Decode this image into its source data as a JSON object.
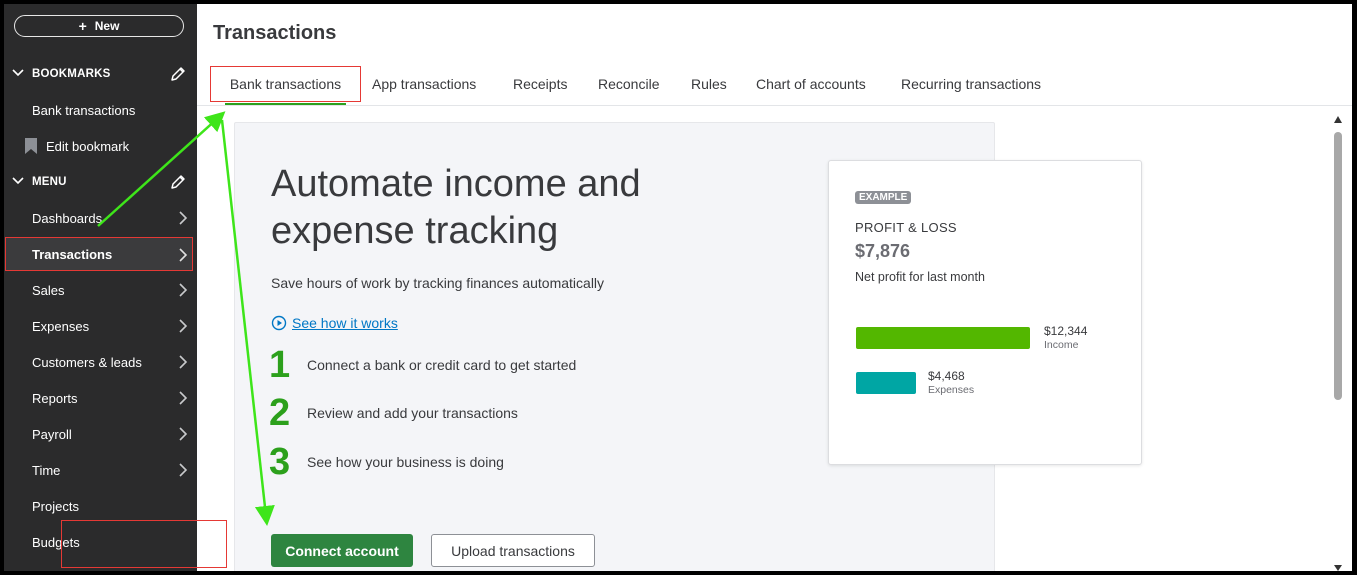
{
  "sidebar": {
    "new_label": "New",
    "bookmarks_header": "BOOKMARKS",
    "bookmarks": [
      {
        "label": "Bank transactions"
      },
      {
        "label": "Edit bookmark",
        "icon": "bookmark-icon"
      }
    ],
    "menu_header": "MENU",
    "menu": [
      {
        "label": "Dashboards",
        "has_arrow": true
      },
      {
        "label": "Transactions",
        "has_arrow": true,
        "active": true
      },
      {
        "label": "Sales",
        "has_arrow": true
      },
      {
        "label": "Expenses",
        "has_arrow": true
      },
      {
        "label": "Customers & leads",
        "has_arrow": true
      },
      {
        "label": "Reports",
        "has_arrow": true
      },
      {
        "label": "Payroll",
        "has_arrow": true
      },
      {
        "label": "Time",
        "has_arrow": true
      },
      {
        "label": "Projects",
        "has_arrow": false
      },
      {
        "label": "Budgets",
        "has_arrow": false
      }
    ]
  },
  "main": {
    "page_title": "Transactions",
    "tabs": [
      {
        "label": "Bank transactions",
        "selected": true
      },
      {
        "label": "App transactions"
      },
      {
        "label": "Receipts"
      },
      {
        "label": "Reconcile"
      },
      {
        "label": "Rules"
      },
      {
        "label": "Chart of accounts"
      },
      {
        "label": "Recurring transactions"
      }
    ],
    "hero_title": "Automate income and expense tracking",
    "hero_subtitle": "Save hours of work by tracking finances automatically",
    "how_link": "See how it works",
    "steps": [
      {
        "num": "1",
        "text": "Connect a bank or credit card to get started"
      },
      {
        "num": "2",
        "text": "Review and add your transactions"
      },
      {
        "num": "3",
        "text": "See how your business is doing"
      }
    ],
    "connect_button": "Connect account",
    "upload_button": "Upload transactions"
  },
  "example_card": {
    "badge": "EXAMPLE",
    "title": "PROFIT & LOSS",
    "amount": "$7,876",
    "note": "Net profit for last month",
    "income_value": "$12,344",
    "income_label": "Income",
    "income_amount": 12344,
    "expenses_value": "$4,468",
    "expenses_label": "Expenses",
    "expenses_amount": 4468
  },
  "colors": {
    "sidebar_bg": "#2b2b2c",
    "brand_green": "#2ca01c",
    "button_green": "#2e8540",
    "income_bar": "#53b700",
    "expenses_bar": "#00a6a4",
    "highlight_red": "#e53935",
    "annotation_arrow": "#3ee51a"
  }
}
